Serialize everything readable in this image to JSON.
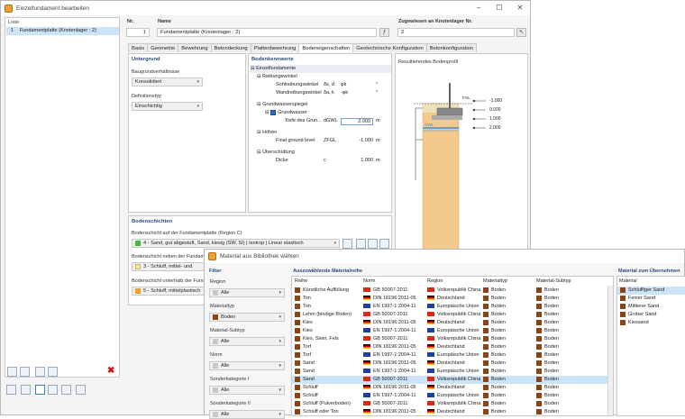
{
  "main_window": {
    "title": "Einzelfundament bearbeiten",
    "list_header": "Liste",
    "list_items": [
      {
        "no": "1",
        "label": "Fundamentplatte (Knotenlager : 2)"
      }
    ],
    "nr_label": "Nr.",
    "nr_value": "1",
    "name_label": "Name",
    "name_value": "Fundamentplatte (Knotenlager : 2)",
    "assigned_label": "Zugewiesen an Knotenlager Nr.",
    "assigned_value": "2",
    "tabs": [
      "Basis",
      "Geometrie",
      "Bewehrung",
      "Betondeckung",
      "Plattenbewehrung",
      "Bodeneigenschaften",
      "Geotechnische Konfiguration",
      "Betonkonfiguration"
    ],
    "active_tab": "Bodeneigenschaften"
  },
  "untergrund": {
    "header": "Untergrund",
    "baugrund_label": "Baugrundverhältnisse",
    "baugrund_value": "Konsolidiert",
    "definition_label": "Definitionstyp",
    "definition_value": "Einschichtig"
  },
  "bodenkennwerte": {
    "header": "Bodenkennwerte",
    "rows": [
      {
        "label": "Einzelfundamente",
        "symbol": "",
        "value": "",
        "unit": ""
      },
      {
        "label": "Reibungswinkel",
        "symbol": "",
        "value": "",
        "unit": ""
      },
      {
        "label": "Sohlreibungswinkel",
        "symbol": "δs, d",
        "value": "φk",
        "unit": "°"
      },
      {
        "label": "Wandreibungswinkel",
        "symbol": "δa, k",
        "value": "-φk",
        "unit": "°"
      },
      {
        "label": "Grundwasserspiegel",
        "symbol": "",
        "value": "",
        "unit": ""
      },
      {
        "label": "Grundwasser",
        "symbol": "",
        "value": "",
        "unit": ""
      },
      {
        "label": "Tiefe des Grun...",
        "symbol": "dGWL",
        "value": "2.000",
        "unit": "m"
      },
      {
        "label": "Höhen",
        "symbol": "",
        "value": "",
        "unit": ""
      },
      {
        "label": "Final ground level",
        "symbol": "ZFGL",
        "value": "-1.000",
        "unit": "m"
      },
      {
        "label": "Überschüttung",
        "symbol": "",
        "value": "",
        "unit": ""
      },
      {
        "label": "Dicke",
        "symbol": "c",
        "value": "1.000",
        "unit": "m"
      }
    ]
  },
  "profile": {
    "header": "Resultierendes Bodenprofil",
    "fgl_label": "FGL",
    "gwl_label": "GWL",
    "levels": [
      "-1.000",
      "0.000",
      "1.000",
      "2.000"
    ],
    "soil_color": "#f3c98c",
    "water_color": "#3a8fd6"
  },
  "bodenschichten": {
    "header": "Bodenschichten",
    "below_label": "Bodenschicht auf der Fundamentplatte (Region C)",
    "below_value": "4 - Sand, gut abgestuft, Sand, kiesig (SW, SI) | Isotrop | Linear elastisch",
    "below_color": "#3cc13c",
    "beside_label": "Bodenschicht neben der Fundament",
    "beside_value": "3 - Schluff, mittel- und ausgepr",
    "beside_color": "#f1e7a8",
    "under_label": "Bodenschicht unterhalb der Fundament",
    "under_value": "5 - Schluff, mittelplastisch | Isot",
    "under_color": "#f0a030"
  },
  "material_dialog": {
    "title": "Material aus Bibliothek wählen",
    "filter_header": "Filter",
    "filters": [
      {
        "label": "Region",
        "value": "Alle"
      },
      {
        "label": "Materialtyp",
        "value": "Boden"
      },
      {
        "label": "Material-Subtyp",
        "value": "Alle"
      },
      {
        "label": "Norm",
        "value": "Alle"
      },
      {
        "label": "Sonderkategorie I",
        "value": "Alle"
      },
      {
        "label": "Sonderkategorie II",
        "value": "Alle"
      }
    ],
    "list_header": "Auszuwählende Materialreihe",
    "columns": [
      "Reihe",
      "Norm",
      "Region",
      "Materialtyp",
      "Material-Subtyp"
    ],
    "rows": [
      {
        "reihe": "Künstliche Auffüllung",
        "norm": "GB 50007-2011",
        "region": "Volksrepublik China",
        "typ": "Boden",
        "subtyp": "Boden"
      },
      {
        "reihe": "Ton",
        "norm": "DIN 18196:2011-05",
        "region": "Deutschland",
        "typ": "Boden",
        "subtyp": "Boden"
      },
      {
        "reihe": "Ton",
        "norm": "EN 1997-1:2004-11",
        "region": "Europäische Union",
        "typ": "Boden",
        "subtyp": "Boden"
      },
      {
        "reihe": "Lehm (bindige Böden)",
        "norm": "GB 50007-2011",
        "region": "Volksrepublik China",
        "typ": "Boden",
        "subtyp": "Boden"
      },
      {
        "reihe": "Kies",
        "norm": "DIN 18196:2011-05",
        "region": "Deutschland",
        "typ": "Boden",
        "subtyp": "Boden"
      },
      {
        "reihe": "Kies",
        "norm": "EN 1997-1:2004-11",
        "region": "Europäische Union",
        "typ": "Boden",
        "subtyp": "Boden"
      },
      {
        "reihe": "Kies, Stein, Fels",
        "norm": "GB 50007-2011",
        "region": "Volksrepublik China",
        "typ": "Boden",
        "subtyp": "Boden"
      },
      {
        "reihe": "Torf",
        "norm": "DIN 18196:2011-05",
        "region": "Deutschland",
        "typ": "Boden",
        "subtyp": "Boden"
      },
      {
        "reihe": "Torf",
        "norm": "EN 1997-1:2004-11",
        "region": "Europäische Union",
        "typ": "Boden",
        "subtyp": "Boden"
      },
      {
        "reihe": "Sand",
        "norm": "DIN 18196:2011-05",
        "region": "Deutschland",
        "typ": "Boden",
        "subtyp": "Boden"
      },
      {
        "reihe": "Sand",
        "norm": "EN 1997-1:2004-11",
        "region": "Europäische Union",
        "typ": "Boden",
        "subtyp": "Boden"
      },
      {
        "reihe": "Sand",
        "norm": "GB 50007-2011",
        "region": "Volksrepublik China",
        "typ": "Boden",
        "subtyp": "Boden"
      },
      {
        "reihe": "Schluff",
        "norm": "DIN 18196:2011-05",
        "region": "Deutschland",
        "typ": "Boden",
        "subtyp": "Boden"
      },
      {
        "reihe": "Schluff",
        "norm": "EN 1997-1:2004-11",
        "region": "Europäische Union",
        "typ": "Boden",
        "subtyp": "Boden"
      },
      {
        "reihe": "Schluff (Pulverboden)",
        "norm": "GB 50007-2011",
        "region": "Volksrepublik China",
        "typ": "Boden",
        "subtyp": "Boden"
      },
      {
        "reihe": "Schluff oder Ton",
        "norm": "DIN 18196:2011-05",
        "region": "Deutschland",
        "typ": "Boden",
        "subtyp": "Boden"
      }
    ],
    "selected_row": 11,
    "take_header": "Material zum Übernehmen",
    "take_col": "Material",
    "take_items": [
      "Schluffiger Sand",
      "Feiner Sand",
      "Mittlerer Sand",
      "Grober Sand",
      "Kiessand"
    ]
  }
}
